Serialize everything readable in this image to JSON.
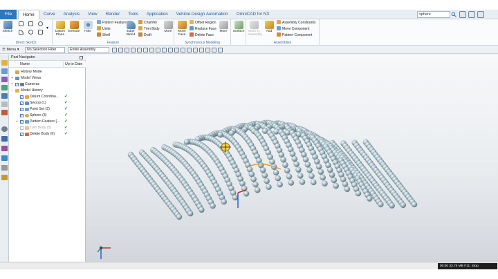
{
  "menu": {
    "file": "File",
    "tabs": [
      "Home",
      "Curve",
      "Analysis",
      "View",
      "Render",
      "Tools",
      "Application",
      "Vehicle Design Automation",
      "OmniCAD for NX"
    ],
    "search_value": "sphere"
  },
  "ribbon": {
    "direct_sketch": {
      "label": "Direct Sketch",
      "sketch": "Sketch"
    },
    "feature": {
      "label": "Feature",
      "datum_plane": "Datum Plane",
      "extrude": "Extrude",
      "hole": "Hole",
      "pattern_feature": "Pattern Feature",
      "unite": "Unite",
      "shell": "Shell",
      "edge_blend": "Edge Blend",
      "chamfer": "Chamfer",
      "trim_body": "Trim Body",
      "draft": "Draft",
      "more": "More"
    },
    "sync": {
      "label": "Synchronous Modeling",
      "move_face": "Move Face",
      "offset_region": "Offset Region",
      "replace_face": "Replace Face",
      "delete_face": "Delete Face",
      "more": "More"
    },
    "surface": {
      "label": "Surface"
    },
    "assemblies": {
      "label": "Assemblies",
      "work_in_assembly": "Work in Assembly",
      "add": "Add",
      "assembly_constraints": "Assembly Constraints",
      "move_component": "Move Component",
      "pattern_component": "Pattern Component"
    }
  },
  "selection_bar": {
    "menu": "Menu",
    "filter": "No Selection Filter",
    "scope": "Entire Assembly"
  },
  "navigator": {
    "title": "Part Navigator",
    "col_name": "Name",
    "col_status": "Up to Date",
    "rows": [
      {
        "name": "History Mode",
        "ok": ""
      },
      {
        "name": "Model Views",
        "ok": ""
      },
      {
        "name": "Cameras",
        "ok": ""
      },
      {
        "name": "Model History",
        "ok": ""
      },
      {
        "name": "Datum Coordina...",
        "ok": "✔"
      },
      {
        "name": "Swoop (1)",
        "ok": "✔"
      },
      {
        "name": "Point Set (2)",
        "ok": "✔"
      },
      {
        "name": "Sphere (3)",
        "ok": "✔"
      },
      {
        "name": "Pattern Feature [...",
        "ok": "✔"
      },
      {
        "name": "Trim Body (5)",
        "ok": "✔"
      },
      {
        "name": "Delete Body (6)",
        "ok": "✔"
      }
    ]
  },
  "status": {
    "text": "00:00  33.75 MB  F11: Stop"
  },
  "colors": {
    "accent": "#2a78c2",
    "sphere": "#b9cdd4",
    "ok": "#1f9a3a"
  }
}
